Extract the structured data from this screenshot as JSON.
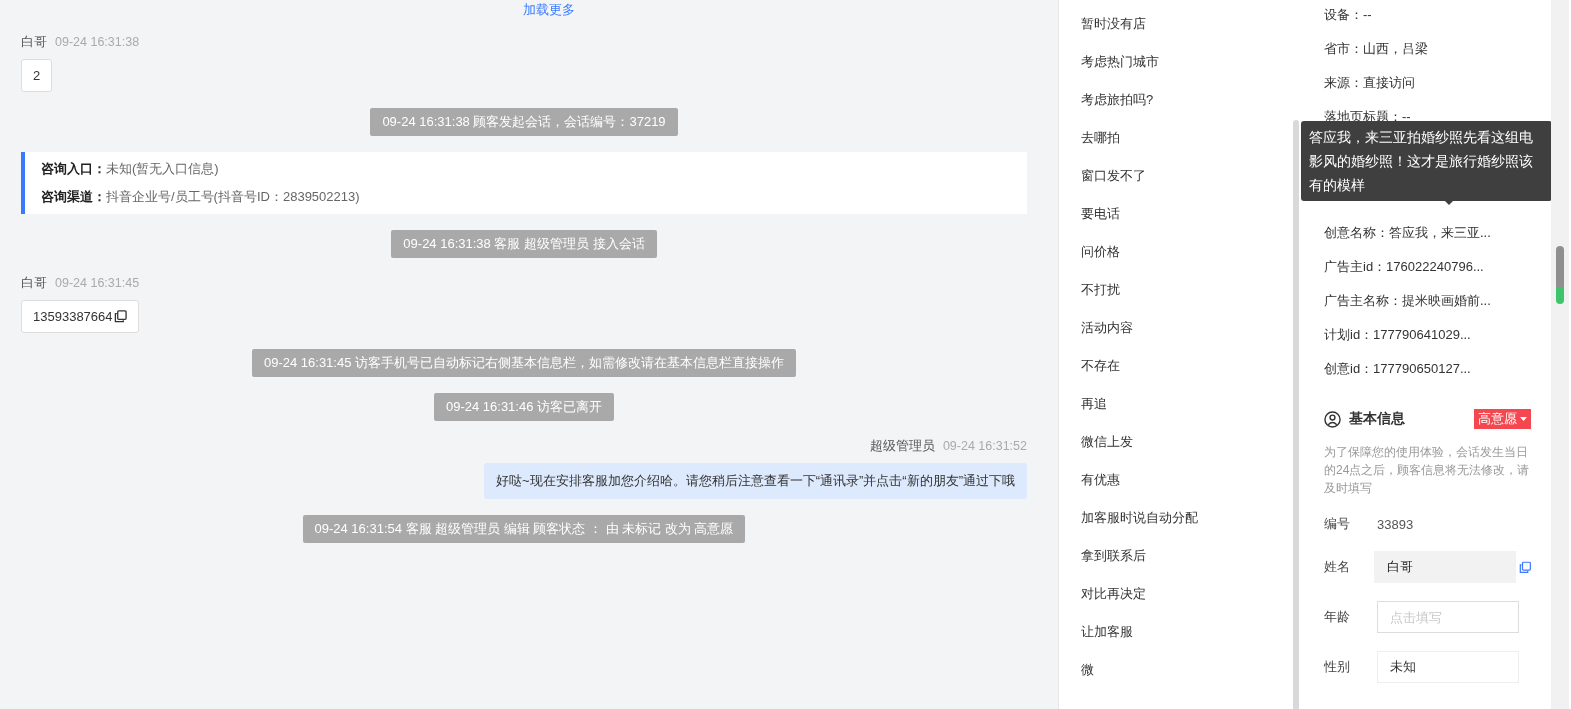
{
  "chat": {
    "load_more": "加载更多",
    "messages": [
      {
        "kind": "visitor",
        "sender": "白哥",
        "time": "09-24 16:31:38",
        "text": "2"
      },
      {
        "kind": "system",
        "text": "09-24 16:31:38 顾客发起会话，会话编号：37219"
      },
      {
        "kind": "entry",
        "lines": [
          {
            "label": "咨询入口：",
            "value": "未知(暂无入口信息)"
          },
          {
            "label": "咨询渠道：",
            "value": "抖音企业号/员工号(抖音号ID：2839502213)"
          }
        ]
      },
      {
        "kind": "system",
        "text": "09-24 16:31:38 客服 超级管理员 接入会话"
      },
      {
        "kind": "visitor",
        "sender": "白哥",
        "time": "09-24 16:31:45",
        "text": "13593387664",
        "copyable": true
      },
      {
        "kind": "system",
        "text": "09-24 16:31:45 访客手机号已自动标记右侧基本信息栏，如需修改请在基本信息栏直接操作"
      },
      {
        "kind": "system",
        "text": "09-24 16:31:46 访客已离开"
      },
      {
        "kind": "agent",
        "sender": "超级管理员",
        "time": "09-24 16:31:52",
        "text": "好哒~现在安排客服加您介绍哈。请您稍后注意查看一下“通讯录”并点击“新的朋友”通过下哦"
      },
      {
        "kind": "system",
        "text": "09-24 16:31:54 客服 超级管理员 编辑 顾客状态 ： 由 未标记 改为 高意愿"
      }
    ]
  },
  "quick_replies": [
    "暂时没有店",
    "考虑热门城市",
    "考虑旅拍吗?",
    "去哪拍",
    "窗口发不了",
    "要电话",
    "问价格",
    "不打扰",
    "活动内容",
    "不存在",
    "再追",
    "微信上发",
    "有优惠",
    "加客服时说自动分配",
    "拿到联系后",
    "对比再决定",
    "让加客服",
    "微"
  ],
  "visit_info": {
    "rows": [
      "设备：--",
      "省市：山西，吕梁",
      "来源：直接访问",
      "落地页标题：--"
    ],
    "tooltip": "答应我，来三亚拍婚纱照先看这组电影风的婚纱照！这才是旅行婚纱照该有的模样",
    "rows_after": [
      "创意名称：答应我，来三亚...",
      "广告主id：176022240796...",
      "广告主名称：提米映画婚前...",
      "计划id：177790641029...",
      "创意id：177790650127..."
    ]
  },
  "basic_info": {
    "title": "基本信息",
    "status": "高意愿",
    "notice": "为了保障您的使用体验，会话发生当日的24点之后，顾客信息将无法修改，请及时填写",
    "id_label": "编号",
    "id_value": "33893",
    "fields": [
      {
        "label": "姓名",
        "value": "白哥",
        "disabled": true,
        "copyable": true
      },
      {
        "label": "年龄",
        "placeholder": "点击填写",
        "disabled": false,
        "copyable": false
      },
      {
        "label": "性别",
        "value": "未知",
        "disabled": false,
        "copyable": false
      }
    ]
  }
}
